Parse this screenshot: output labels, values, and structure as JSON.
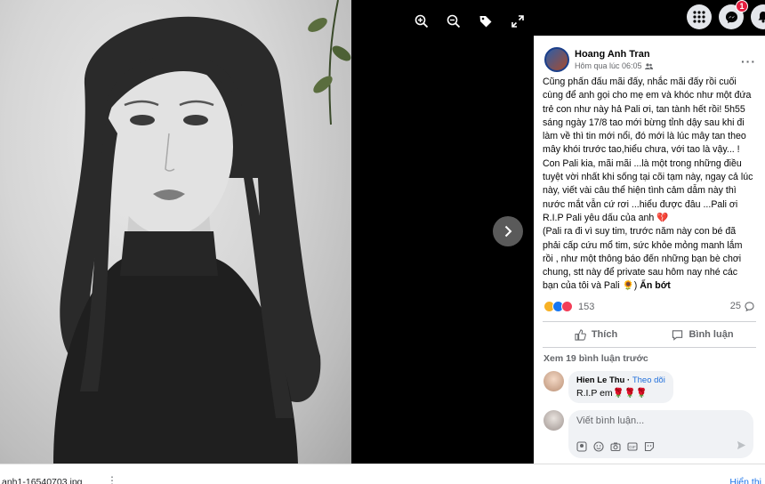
{
  "viewer": {
    "tools": [
      "zoom-in-icon",
      "zoom-out-icon",
      "tag-icon",
      "fullscreen-icon"
    ],
    "next_icon": "chevron-right-icon"
  },
  "header": {
    "icons": [
      "menu-grid-icon",
      "messenger-icon",
      "notifications-icon"
    ],
    "messenger_badge": "1"
  },
  "post": {
    "author": "Hoang Anh Tran",
    "time": "Hôm qua lúc 06:05",
    "text": "Cũng phấn đấu mãi đấy, nhắc mãi đấy rồi cuối cùng để anh gọi cho mẹ em và khóc như một đứa trẻ con như này hả Pali ơi, tan tành hết rồi! 5h55 sáng ngày 17/8 tao mới bừng tỉnh dậy sau khi đi làm về thì tin mới nổi, đó mới là lúc mây tan theo mây khói trước tao,hiểu chưa, với tao là vậy... ! Con Pali kia, mãi mãi ...là một trong những điều tuyệt vời nhất khi sống tại cõi tạm này, ngay cả lúc này, viết vài câu thể hiện tình cảm dẫm này thì nước mắt vẫn cứ rơi ...hiểu được đâu ...Pali ơi R.I.P Pali yêu dấu của anh 💔",
    "text2": "(Pali ra đi vì suy tim, trước năm này con bé đã phải cấp cứu mổ tim, sức khỏe mỏng manh lắm rồi , như một thông báo đến những bạn bè chơi chung, stt này để private sau hôm nay nhé các bạn của tôi và Pali 🌻)",
    "see_less": "Ẩn bớt",
    "reaction_count": "153",
    "comment_count": "25",
    "like_label": "Thích",
    "comment_label": "Bình luận",
    "view_more_comments": "Xem 19 bình luận trước",
    "reaction_colors": [
      "#f7b125",
      "#1877f2",
      "#f33e58"
    ]
  },
  "comment": {
    "name": "Hien Le Thu",
    "follow": "Theo dõi",
    "text": "R.I.P em🌹🌹🌹"
  },
  "composer": {
    "placeholder": "Viết bình luận..."
  },
  "download_bar": {
    "file_name": "anh1-16540703.jpg",
    "show_all": "Hiển thị"
  }
}
